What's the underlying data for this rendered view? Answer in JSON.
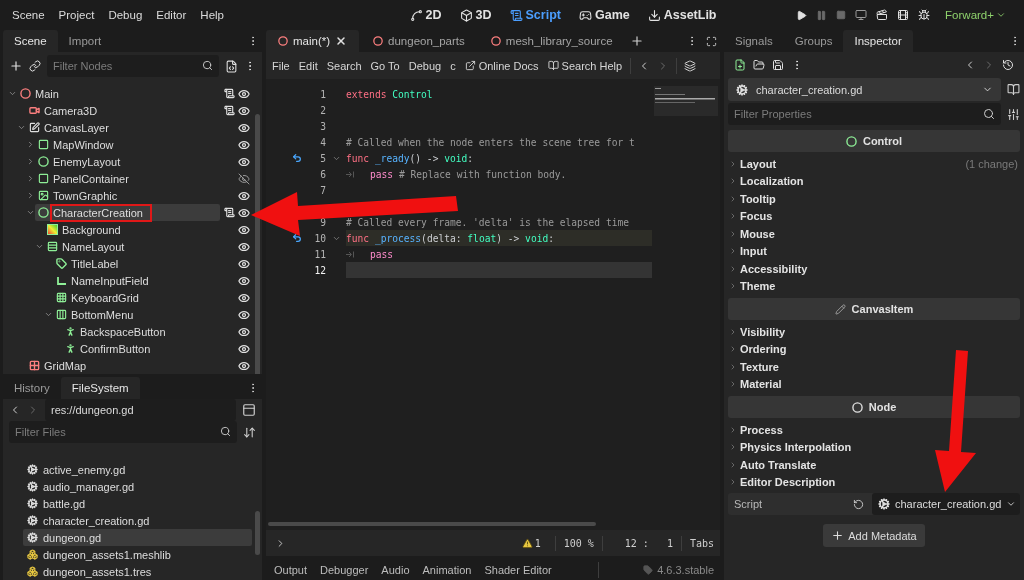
{
  "menu_bar": {
    "menus": [
      "Scene",
      "Project",
      "Debug",
      "Editor",
      "Help"
    ],
    "workspaces": [
      {
        "label": "2D",
        "kind": "move",
        "selected": false
      },
      {
        "label": "3D",
        "kind": "box",
        "selected": false
      },
      {
        "label": "Script",
        "kind": "scroll",
        "selected": true
      },
      {
        "label": "Game",
        "kind": "gamepad",
        "selected": false
      },
      {
        "label": "AssetLib",
        "kind": "download",
        "selected": false
      }
    ],
    "renderer": "Forward+"
  },
  "scene_dock": {
    "tabs": [
      {
        "label": "Scene",
        "selected": true
      },
      {
        "label": "Import",
        "selected": false
      }
    ],
    "filter_placeholder": "Filter Nodes",
    "tree": [
      {
        "name": "Main",
        "kind": "node3d",
        "expanded": true,
        "script": true,
        "visible": true,
        "selected": false,
        "children": [
          {
            "name": "Camera3D",
            "kind": "camera",
            "script": true,
            "visible": true,
            "selected": false
          },
          {
            "name": "CanvasLayer",
            "kind": "canvas",
            "expanded": true,
            "script": false,
            "visible": true,
            "selected": false,
            "children": [
              {
                "name": "MapWindow",
                "kind": "panel",
                "expanded": false,
                "script": false,
                "visible": true,
                "selected": false
              },
              {
                "name": "EnemyLayout",
                "kind": "control",
                "expanded": false,
                "script": false,
                "visible": true,
                "selected": false
              },
              {
                "name": "PanelContainer",
                "kind": "panel",
                "expanded": false,
                "script": false,
                "visible": false,
                "selected": false
              },
              {
                "name": "TownGraphic",
                "kind": "texture",
                "expanded": false,
                "script": false,
                "visible": true,
                "selected": false
              },
              {
                "name": "CharacterCreation",
                "kind": "control",
                "expanded": true,
                "script": true,
                "visible": true,
                "selected": true,
                "children": [
                  {
                    "name": "Background",
                    "kind": "gradient",
                    "script": false,
                    "visible": true,
                    "selected": false
                  },
                  {
                    "name": "NameLayout",
                    "kind": "vbox",
                    "expanded": true,
                    "script": false,
                    "visible": true,
                    "selected": false,
                    "children": [
                      {
                        "name": "TitleLabel",
                        "kind": "label",
                        "script": false,
                        "visible": true,
                        "selected": false
                      },
                      {
                        "name": "NameInputField",
                        "kind": "lineedit",
                        "script": false,
                        "visible": true,
                        "selected": false
                      },
                      {
                        "name": "KeyboardGrid",
                        "kind": "grid",
                        "script": false,
                        "visible": true,
                        "selected": false
                      },
                      {
                        "name": "BottomMenu",
                        "kind": "hbox",
                        "expanded": true,
                        "script": false,
                        "visible": true,
                        "selected": false,
                        "children": [
                          {
                            "name": "BackspaceButton",
                            "kind": "button",
                            "script": false,
                            "visible": true,
                            "selected": false
                          },
                          {
                            "name": "ConfirmButton",
                            "kind": "button",
                            "script": false,
                            "visible": true,
                            "selected": false
                          }
                        ]
                      }
                    ]
                  }
                ]
              }
            ]
          },
          {
            "name": "GridMap",
            "kind": "gridmap",
            "script": false,
            "visible": true,
            "selected": false
          }
        ]
      }
    ]
  },
  "filesystem_dock": {
    "tabs": [
      {
        "label": "History",
        "selected": false
      },
      {
        "label": "FileSystem",
        "selected": true
      }
    ],
    "path": "res://dungeon.gd",
    "filter_placeholder": "Filter Files",
    "files": [
      {
        "name": "active_enemy.gd",
        "kind": "script",
        "selected": false
      },
      {
        "name": "audio_manager.gd",
        "kind": "script",
        "selected": false
      },
      {
        "name": "battle.gd",
        "kind": "script",
        "selected": false
      },
      {
        "name": "character_creation.gd",
        "kind": "script",
        "selected": false
      },
      {
        "name": "dungeon.gd",
        "kind": "script",
        "selected": true
      },
      {
        "name": "dungeon_assets1.meshlib",
        "kind": "meshlib",
        "selected": false
      },
      {
        "name": "dungeon_assets1.tres",
        "kind": "meshlib",
        "selected": false
      }
    ]
  },
  "script_editor": {
    "tabs": [
      {
        "label": "main(*)",
        "selected": true,
        "closable": true
      },
      {
        "label": "dungeon_parts",
        "selected": false,
        "closable": false
      },
      {
        "label": "mesh_library_source",
        "selected": false,
        "closable": false
      }
    ],
    "menus": [
      "File",
      "Edit",
      "Search",
      "Go To",
      "Debug",
      "c"
    ],
    "links": [
      {
        "label": "Online Docs",
        "kind": "external"
      },
      {
        "label": "Search Help",
        "kind": "doc"
      }
    ],
    "lines": [
      {
        "number": "1",
        "current": false,
        "marked": false,
        "connected": false,
        "foldable": false,
        "tokens": [
          {
            "kind": "keyword",
            "text": "extends "
          },
          {
            "kind": "type",
            "text": "Control"
          }
        ]
      },
      {
        "number": "2",
        "current": false,
        "marked": false,
        "connected": false,
        "foldable": false
      },
      {
        "number": "3",
        "current": false,
        "marked": false,
        "connected": false,
        "foldable": false
      },
      {
        "number": "4",
        "current": false,
        "marked": false,
        "connected": false,
        "foldable": false,
        "tokens": [
          {
            "kind": "comment",
            "text": "# Called when the node enters the scene tree for t"
          }
        ]
      },
      {
        "number": "5",
        "current": false,
        "marked": false,
        "connected": true,
        "foldable": true,
        "tokens": [
          {
            "kind": "keyword",
            "text": "func "
          },
          {
            "kind": "function",
            "text": "_ready"
          },
          {
            "kind": "plain",
            "text": "() -> "
          },
          {
            "kind": "type",
            "text": "void"
          },
          {
            "kind": "plain",
            "text": ":"
          }
        ]
      },
      {
        "number": "6",
        "current": false,
        "marked": false,
        "connected": false,
        "foldable": false,
        "tokens": [
          {
            "kind": "indent"
          },
          {
            "kind": "control",
            "text": "pass"
          },
          {
            "kind": "comment",
            "text": " # Replace with function body."
          }
        ]
      },
      {
        "number": "7",
        "current": false,
        "marked": false,
        "connected": false,
        "foldable": false
      },
      {
        "current": false,
        "marked": false,
        "connected": false,
        "foldable": false
      },
      {
        "number": "9",
        "current": false,
        "marked": false,
        "connected": false,
        "foldable": false,
        "tokens": [
          {
            "kind": "comment",
            "text": "# Called every frame. 'delta' is the elapsed time"
          }
        ]
      },
      {
        "number": "10",
        "current": false,
        "marked": true,
        "connected": true,
        "foldable": true,
        "tokens": [
          {
            "kind": "keyword",
            "text": "func "
          },
          {
            "kind": "function",
            "text": "_process"
          },
          {
            "kind": "plain",
            "text": "(delta: "
          },
          {
            "kind": "type",
            "text": "float"
          },
          {
            "kind": "plain",
            "text": ") -> "
          },
          {
            "kind": "type",
            "text": "void"
          },
          {
            "kind": "plain",
            "text": ":"
          }
        ]
      },
      {
        "number": "11",
        "current": false,
        "marked": false,
        "connected": false,
        "foldable": false,
        "tokens": [
          {
            "kind": "indent"
          },
          {
            "kind": "control",
            "text": "pass"
          }
        ]
      },
      {
        "number": "12",
        "current": true,
        "marked": false,
        "connected": false,
        "foldable": false
      }
    ],
    "status": {
      "warnings": "1",
      "zoom": "100 %",
      "line": "12 :",
      "column": "1",
      "indent_mode": "Tabs"
    }
  },
  "bottom_panel": {
    "tabs": [
      "Output",
      "Debugger",
      "Audio",
      "Animation",
      "Shader Editor"
    ],
    "version": "4.6.3.stable"
  },
  "inspector_dock": {
    "tabs": [
      {
        "label": "Signals",
        "selected": false
      },
      {
        "label": "Groups",
        "selected": false
      },
      {
        "label": "Inspector",
        "selected": true
      }
    ],
    "resource": "character_creation.gd",
    "filter_placeholder": "Filter Properties",
    "sections": [
      {
        "title": "Control",
        "kind": "control",
        "groups": [
          {
            "label": "Layout",
            "note": "(1 change)"
          },
          {
            "label": "Localization"
          },
          {
            "label": "Tooltip"
          },
          {
            "label": "Focus"
          },
          {
            "label": "Mouse"
          },
          {
            "label": "Input"
          },
          {
            "label": "Accessibility"
          },
          {
            "label": "Theme"
          }
        ]
      },
      {
        "title": "CanvasItem",
        "kind": "canvas_item",
        "groups": [
          {
            "label": "Visibility"
          },
          {
            "label": "Ordering"
          },
          {
            "label": "Texture"
          },
          {
            "label": "Material"
          }
        ]
      },
      {
        "title": "Node",
        "kind": "node",
        "groups": [
          {
            "label": "Process"
          },
          {
            "label": "Physics Interpolation"
          },
          {
            "label": "Auto Translate"
          },
          {
            "label": "Editor Description"
          }
        ]
      }
    ],
    "script_property": {
      "label": "Script",
      "value": "character_creation.gd"
    },
    "add_button": "Add Metadata"
  }
}
